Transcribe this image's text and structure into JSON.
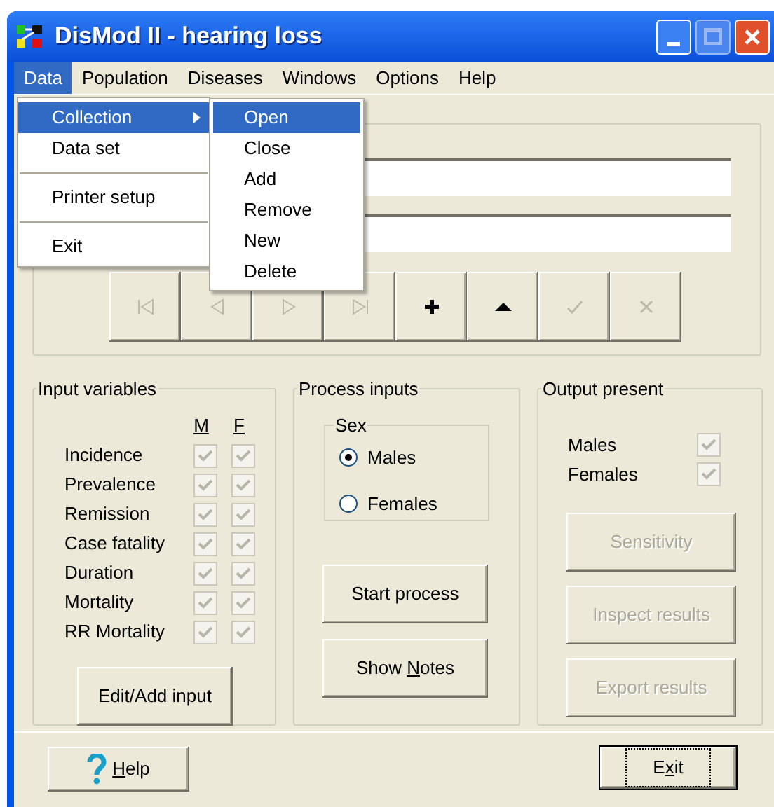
{
  "window": {
    "title": "DisMod II - hearing loss"
  },
  "menu_bar": [
    {
      "label": "Data",
      "selected": true
    },
    {
      "label": "Population",
      "selected": false
    },
    {
      "label": "Diseases",
      "selected": false
    },
    {
      "label": "Windows",
      "selected": false
    },
    {
      "label": "Options",
      "selected": false
    },
    {
      "label": "Help",
      "selected": false
    }
  ],
  "data_menu": [
    {
      "kind": "item",
      "label": "Collection",
      "selected": true,
      "submenu": true
    },
    {
      "kind": "item",
      "label": "Data set",
      "selected": false,
      "submenu": false
    },
    {
      "kind": "separator"
    },
    {
      "kind": "item",
      "label": "Printer setup",
      "selected": false,
      "submenu": false
    },
    {
      "kind": "separator"
    },
    {
      "kind": "item",
      "label": "Exit",
      "selected": false,
      "submenu": false
    }
  ],
  "collection_submenu": [
    {
      "label": "Open",
      "selected": true
    },
    {
      "label": "Close",
      "selected": false
    },
    {
      "label": "Add",
      "selected": false
    },
    {
      "label": "Remove",
      "selected": false
    },
    {
      "label": "New",
      "selected": false
    },
    {
      "label": "Delete",
      "selected": false
    }
  ],
  "record_navigator": [
    {
      "kind": "first",
      "disabled": true
    },
    {
      "kind": "prev",
      "disabled": true
    },
    {
      "kind": "next",
      "disabled": true
    },
    {
      "kind": "last",
      "disabled": true
    },
    {
      "kind": "add",
      "disabled": false
    },
    {
      "kind": "up",
      "disabled": false
    },
    {
      "kind": "check",
      "disabled": true
    },
    {
      "kind": "cancel",
      "disabled": true
    }
  ],
  "input_variables": {
    "title": "Input variables",
    "column_headers": [
      "M",
      "F"
    ],
    "rows": [
      {
        "label": "Incidence",
        "m": {
          "checked": true,
          "disabled": true
        },
        "f": {
          "checked": true,
          "disabled": true
        }
      },
      {
        "label": "Prevalence",
        "m": {
          "checked": true,
          "disabled": true
        },
        "f": {
          "checked": true,
          "disabled": true
        }
      },
      {
        "label": "Remission",
        "m": {
          "checked": true,
          "disabled": true
        },
        "f": {
          "checked": true,
          "disabled": true
        }
      },
      {
        "label": "Case fatality",
        "m": {
          "checked": true,
          "disabled": true
        },
        "f": {
          "checked": true,
          "disabled": true
        }
      },
      {
        "label": "Duration",
        "m": {
          "checked": true,
          "disabled": true
        },
        "f": {
          "checked": true,
          "disabled": true
        }
      },
      {
        "label": "Mortality",
        "m": {
          "checked": true,
          "disabled": true
        },
        "f": {
          "checked": true,
          "disabled": true
        }
      },
      {
        "label": "RR Mortality",
        "m": {
          "checked": true,
          "disabled": true
        },
        "f": {
          "checked": true,
          "disabled": true
        }
      }
    ],
    "button": {
      "label_parts": [
        {
          "text": "Edit/Add input",
          "underline": false
        }
      ],
      "disabled": false
    }
  },
  "process_inputs": {
    "title": "Process inputs",
    "sex_group": {
      "title": "Sex",
      "options": [
        {
          "label": "Males",
          "selected": true
        },
        {
          "label": "Females",
          "selected": false
        }
      ]
    },
    "buttons": [
      {
        "label_parts": [
          {
            "text": "Start process",
            "underline": false
          }
        ],
        "disabled": false
      },
      {
        "label_parts": [
          {
            "text": "Show ",
            "underline": false
          },
          {
            "text": "N",
            "underline": true
          },
          {
            "text": "otes",
            "underline": false
          }
        ],
        "disabled": false
      }
    ]
  },
  "output_present": {
    "title": "Output present",
    "rows": [
      {
        "label": "Males",
        "checked": true,
        "disabled": true
      },
      {
        "label": "Females",
        "checked": true,
        "disabled": true
      }
    ],
    "buttons": [
      {
        "label_parts": [
          {
            "text": "Sensitivity",
            "underline": false
          }
        ],
        "disabled": true
      },
      {
        "label_parts": [
          {
            "text": "Inspect results",
            "underline": false
          }
        ],
        "disabled": true
      },
      {
        "label_parts": [
          {
            "text": "Export results",
            "underline": false
          }
        ],
        "disabled": true
      }
    ]
  },
  "footer": {
    "help_button": {
      "label_parts": [
        {
          "text": "H",
          "underline": true
        },
        {
          "text": "elp",
          "underline": false
        }
      ],
      "disabled": false,
      "focused": false
    },
    "exit_button": {
      "label_parts": [
        {
          "text": "E",
          "underline": false
        },
        {
          "text": "x",
          "underline": true
        },
        {
          "text": "it",
          "underline": false
        }
      ],
      "disabled": false,
      "focused": true
    }
  }
}
